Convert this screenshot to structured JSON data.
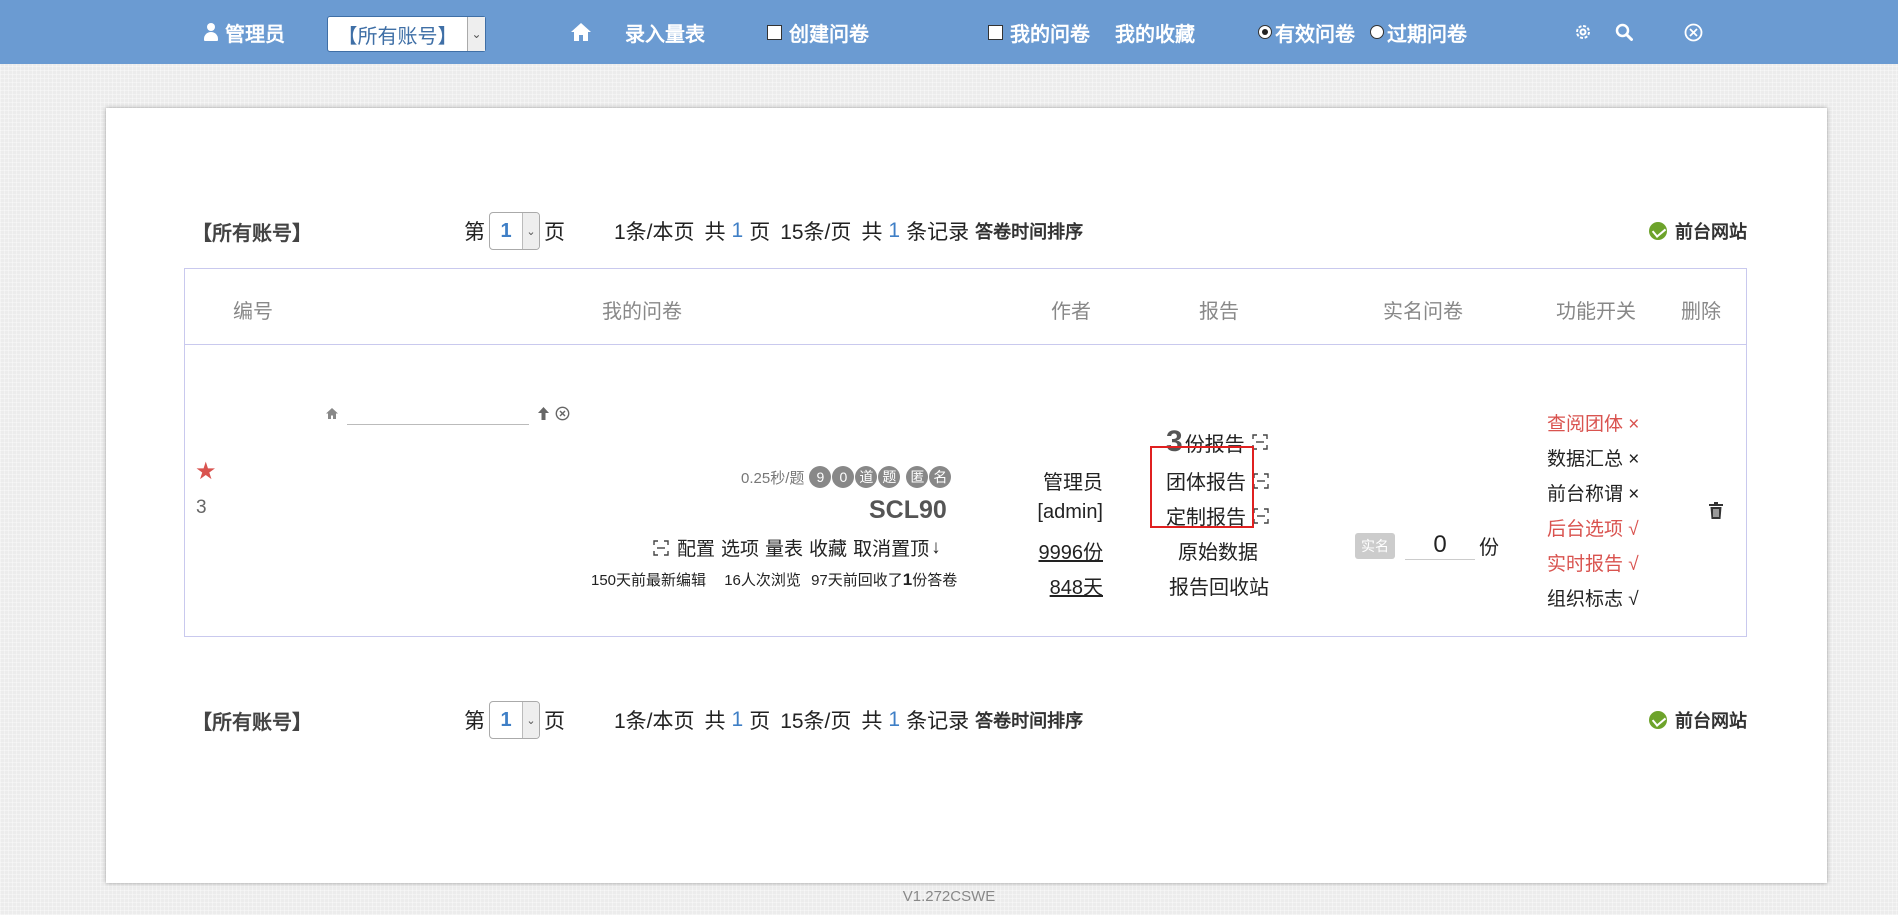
{
  "topbar": {
    "user_label": "管理员",
    "account_select": "【所有账号】",
    "enter_scale": "录入量表",
    "create_survey": "创建问卷",
    "my_surveys": "我的问卷",
    "my_favorites": "我的收藏",
    "valid_surveys": "有效问卷",
    "expired_surveys": "过期问卷"
  },
  "pager": {
    "account": "【所有账号】",
    "page_prefix": "第",
    "page_number": "1",
    "page_suffix": "页",
    "per_page_1": "1条/本页",
    "total_prefix": "共",
    "total_pages": "1",
    "page_unit": "页",
    "per_page_15": "15条/页",
    "records_prefix": "共",
    "total_records": "1",
    "records_suffix": "条记录",
    "sort_label": "答卷时间排序",
    "site_link": "前台网站"
  },
  "table": {
    "headers": [
      "编号",
      "我的问卷",
      "作者",
      "报告",
      "实名问卷",
      "功能开关",
      "删除"
    ],
    "row": {
      "index": "3",
      "speed": "0.25秒/题",
      "badges": [
        "9",
        "0",
        "道",
        "题",
        "匿",
        "名"
      ],
      "title": "SCL90",
      "actions": [
        "配置",
        "选项",
        "量表",
        "收藏",
        "取消置顶"
      ],
      "sort_arrow": "↓",
      "meta_edit": "150天前最新编辑",
      "meta_views": "16人次浏览",
      "meta_recycle_prefix": "97天前回收了",
      "meta_recycle_count": "1",
      "meta_recycle_suffix": "份答卷",
      "author_name": "管理员",
      "author_account": "[admin]",
      "author_copies": "9996份",
      "author_days": "848天",
      "report_count": "3",
      "report_count_suffix": "份报告",
      "report_group": "团体报告",
      "report_custom": "定制报告",
      "report_raw": "原始数据",
      "report_recycle": "报告回收站",
      "realname_tag": "实名",
      "realname_value": "0",
      "realname_unit": "份",
      "functions": [
        {
          "label": "查阅团体 ×",
          "color": "#d9534f"
        },
        {
          "label": "数据汇总 ×",
          "color": "#222222"
        },
        {
          "label": "前台称谓 ×",
          "color": "#222222"
        },
        {
          "label": "后台选项 √",
          "color": "#d9534f"
        },
        {
          "label": "实时报告 √",
          "color": "#d9534f"
        },
        {
          "label": "组织标志 √",
          "color": "#222222"
        }
      ]
    }
  },
  "version": "V1.272CSWE"
}
